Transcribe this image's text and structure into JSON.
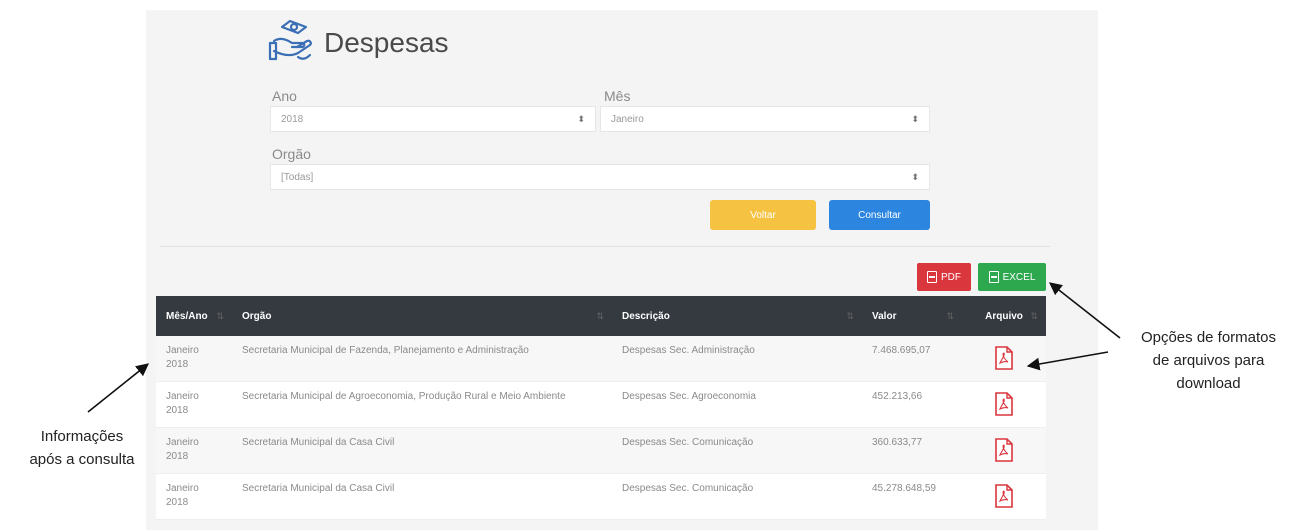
{
  "page": {
    "title": "Despesas",
    "title_icon": "hands-money-icon"
  },
  "filters": {
    "year_label": "Ano",
    "year_value": "2018",
    "month_label": "Mês",
    "month_value": "Janeiro",
    "org_label": "Orgão",
    "org_value": "[Todas]"
  },
  "buttons": {
    "back_label": "Voltar",
    "query_label": "Consultar",
    "pdf_label": "PDF",
    "excel_label": "EXCEL"
  },
  "table": {
    "columns": [
      "Mês/Ano",
      "Orgão",
      "Descrição",
      "Valor",
      "Arquivo"
    ],
    "rows": [
      {
        "month": "Janeiro",
        "year": "2018",
        "org": "Secretaria Municipal de Fazenda, Planejamento e Administração",
        "desc": "Despesas Sec. Administração",
        "value": "7.468.695,07"
      },
      {
        "month": "Janeiro",
        "year": "2018",
        "org": "Secretaria Municipal de Agroeconomia, Produção Rural e Meio Ambiente",
        "desc": "Despesas Sec. Agroeconomia",
        "value": "452.213,66"
      },
      {
        "month": "Janeiro",
        "year": "2018",
        "org": "Secretaria Municipal da Casa Civil",
        "desc": "Despesas Sec. Comunicação",
        "value": "360.633,77"
      },
      {
        "month": "Janeiro",
        "year": "2018",
        "org": "Secretaria Municipal da Casa Civil",
        "desc": "Despesas Sec. Comunicação",
        "value": "45.278.648,59"
      }
    ]
  },
  "annotations": {
    "left_line1": "Informações",
    "left_line2": "após a consulta",
    "right_line1": "Opções de formatos",
    "right_line2": "de arquivos para",
    "right_line3": "download"
  },
  "colors": {
    "header_dark": "#343a40",
    "btn_back": "#f5c242",
    "btn_query": "#2c86e0",
    "btn_pdf": "#d9363e",
    "btn_excel": "#2ea84f",
    "pdf_icon": "#d9363e"
  }
}
